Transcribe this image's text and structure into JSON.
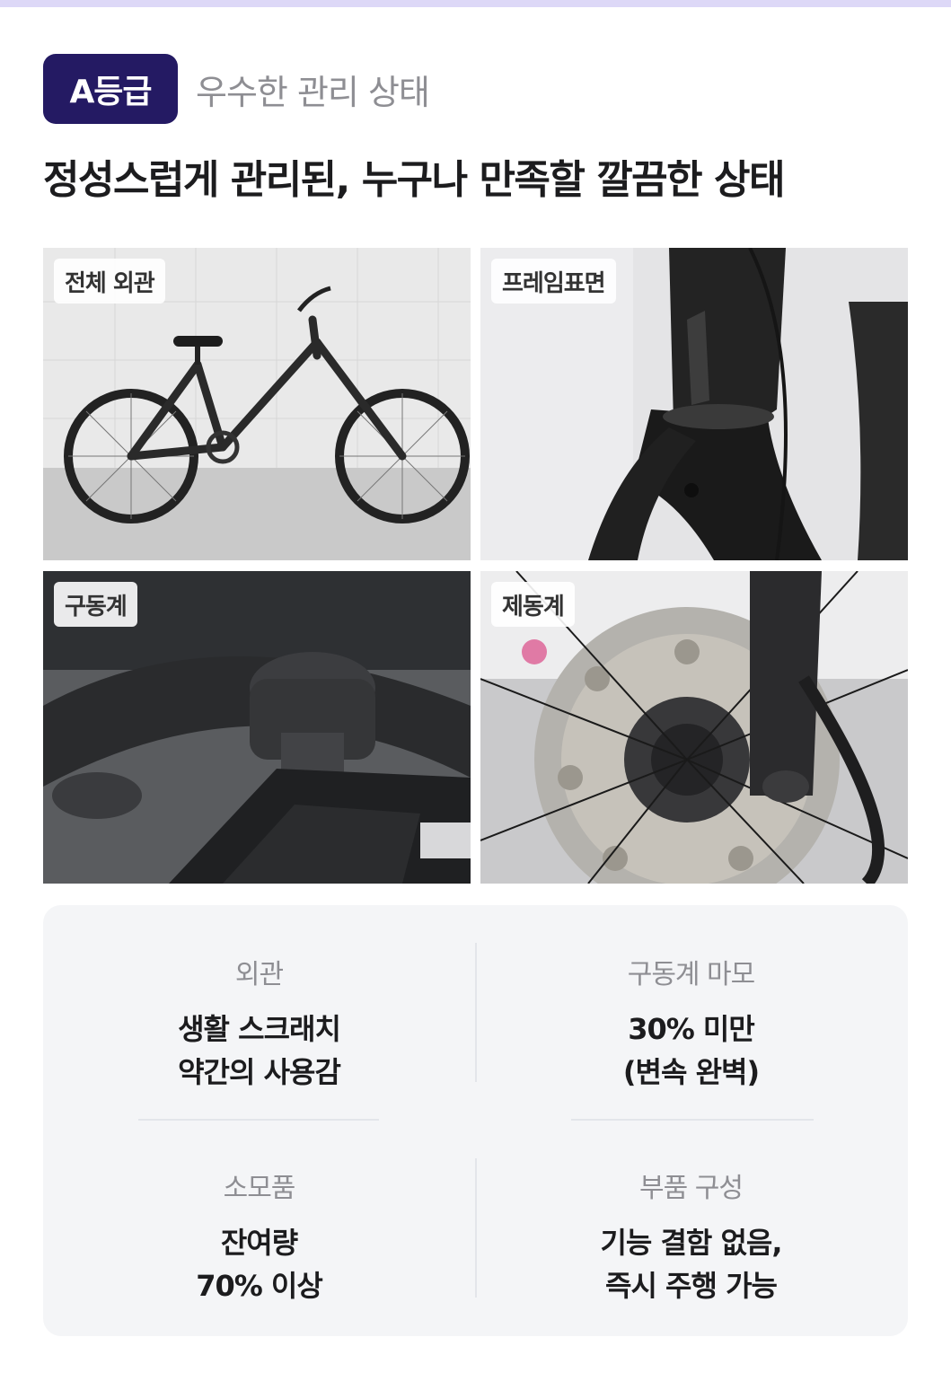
{
  "grade": {
    "badge": "A등급",
    "description": "우수한 관리 상태"
  },
  "headline": "정성스럽게 관리된, 누구나 만족할 깔끔한 상태",
  "photos": [
    {
      "label": "전체 외관"
    },
    {
      "label": "프레임표면"
    },
    {
      "label": "구동계"
    },
    {
      "label": "제동계"
    }
  ],
  "specs": [
    {
      "label": "외관",
      "line1": "생활 스크래치",
      "line2": "약간의 사용감"
    },
    {
      "label": "구동계 마모",
      "line1": "30% 미만",
      "line2": "(변속 완벽)"
    },
    {
      "label": "소모품",
      "line1": "잔여량",
      "line2": "70% 이상"
    },
    {
      "label": "부품 구성",
      "line1": "기능 결함 없음,",
      "line2": "즉시 주행 가능"
    }
  ],
  "colors": {
    "badge_bg": "#241a63",
    "top_strip": "#ddd8f7",
    "panel_bg": "#f4f5f7"
  }
}
